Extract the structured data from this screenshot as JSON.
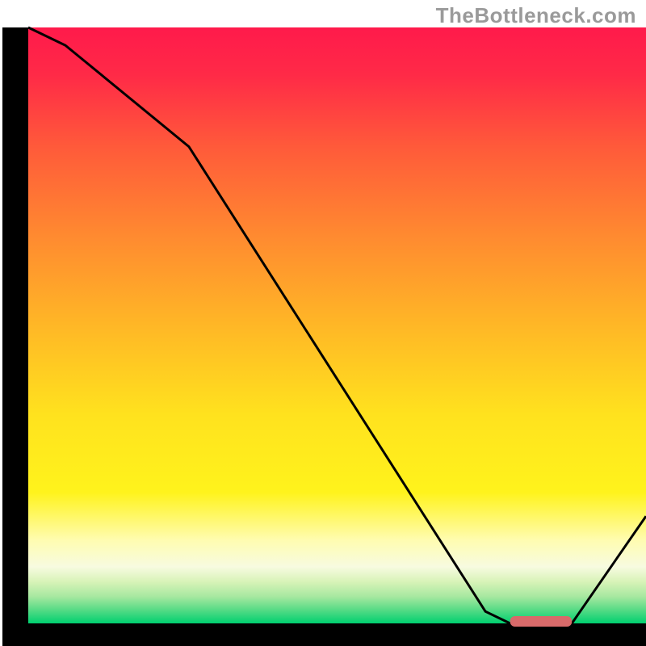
{
  "watermark": "TheBottleneck.com",
  "chart_data": {
    "type": "line",
    "title": "",
    "xlabel": "",
    "ylabel": "",
    "xlim": [
      0,
      100
    ],
    "ylim": [
      0,
      100
    ],
    "grid": false,
    "legend": false,
    "annotations": [],
    "series": [
      {
        "name": "curve",
        "x": [
          0,
          6,
          26,
          74,
          78,
          88,
          100
        ],
        "y": [
          100,
          97,
          80,
          2,
          0,
          0,
          18
        ]
      }
    ],
    "optimum_band": {
      "x_start": 78,
      "x_end": 88,
      "y": 0
    },
    "background_gradient": {
      "stops": [
        {
          "offset": 0.0,
          "color": "#ff1a4b"
        },
        {
          "offset": 0.08,
          "color": "#ff2a47"
        },
        {
          "offset": 0.2,
          "color": "#ff5a3a"
        },
        {
          "offset": 0.35,
          "color": "#ff8a30"
        },
        {
          "offset": 0.5,
          "color": "#ffb726"
        },
        {
          "offset": 0.65,
          "color": "#ffe21e"
        },
        {
          "offset": 0.78,
          "color": "#fff31c"
        },
        {
          "offset": 0.86,
          "color": "#fffcb0"
        },
        {
          "offset": 0.905,
          "color": "#f7fbe0"
        },
        {
          "offset": 0.93,
          "color": "#d8f3b8"
        },
        {
          "offset": 0.955,
          "color": "#a7e8a0"
        },
        {
          "offset": 0.975,
          "color": "#5fdc88"
        },
        {
          "offset": 1.0,
          "color": "#00d070"
        }
      ]
    },
    "frame_color": "#000000",
    "line_color": "#000000",
    "marker_color": "#d86a6a"
  }
}
